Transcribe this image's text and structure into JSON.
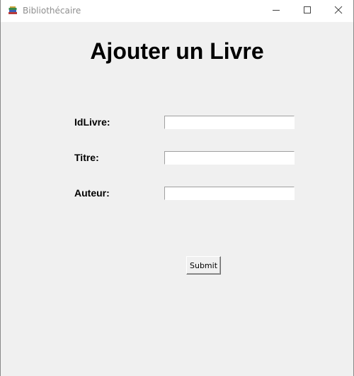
{
  "window": {
    "title": "Bibliothécaire",
    "icon": "books-icon",
    "controls": [
      "minimize-icon",
      "maximize-icon",
      "close-icon"
    ]
  },
  "form": {
    "heading": "Ajouter un Livre",
    "fields": [
      {
        "label": "IdLivre:",
        "value": ""
      },
      {
        "label": "Titre:",
        "value": ""
      },
      {
        "label": "Auteur:",
        "value": ""
      }
    ],
    "submit_label": "Submit"
  },
  "colors": {
    "window_bg": "#f0f0f0",
    "titlebar_bg": "#ffffff",
    "title_text": "#8f8f8f"
  }
}
